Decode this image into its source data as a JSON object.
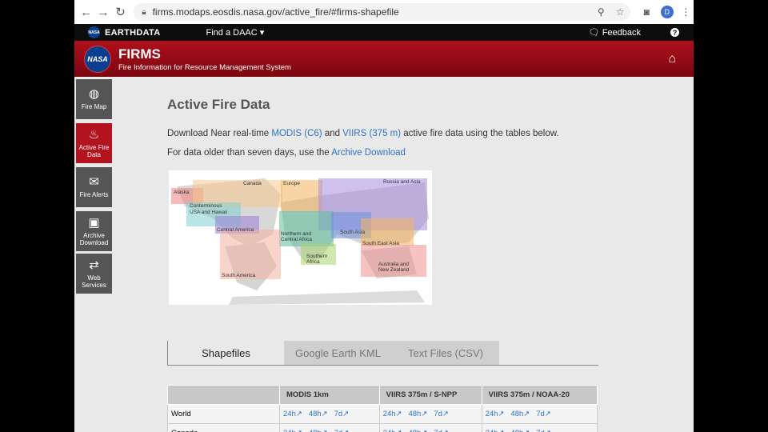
{
  "browser": {
    "url": "firms.modaps.eosdis.nasa.gov/active_fire/#firms-shapefile",
    "profile_initial": "D"
  },
  "earthdata": {
    "nasa_mark": "NASA",
    "brand": "EARTHDATA",
    "find_daac": "Find a DAAC ▾",
    "feedback": "Feedback",
    "help": "?"
  },
  "banner": {
    "logo": "NASA",
    "title": "FIRMS",
    "subtitle": "Fire Information for Resource Management System"
  },
  "sidebar": {
    "items": [
      {
        "label": "Fire Map",
        "icon": "globe-icon"
      },
      {
        "label": "Active Fire Data",
        "icon": "flame-icon"
      },
      {
        "label": "Fire Alerts",
        "icon": "envelope-icon"
      },
      {
        "label": "Archive Download",
        "icon": "archive-box-icon"
      },
      {
        "label": "Web Services",
        "icon": "swap-arrows-icon"
      }
    ]
  },
  "main": {
    "heading": "Active Fire Data",
    "p1_pre": "Download Near real-time ",
    "p1_link1": "MODIS (C6)",
    "p1_mid": " and ",
    "p1_link2": "VIIRS (375 m)",
    "p1_post": " active fire data using the tables below.",
    "p2_pre": "For data older than seven days, use the ",
    "p2_link": "Archive Download"
  },
  "map": {
    "regions": {
      "alaska": "Alaska",
      "canada": "Canada",
      "europe": "Europe",
      "russia": "Russia and Asia",
      "usa_line1": "Conterminous",
      "usa_line2": "USA and Hawaii",
      "central_america": "Central America",
      "n_africa_line1": "Northern and",
      "n_africa_line2": "Central Africa",
      "south_asia": "South Asia",
      "se_asia": "South East Asia",
      "s_africa_line1": "Southern",
      "s_africa_line2": "Africa",
      "australia_line1": "Australia and",
      "australia_line2": "New Zealand",
      "south_america": "South America"
    },
    "colors": {
      "alaska": "#f08080",
      "canada": "#f7c98c",
      "europe": "#f3b25f",
      "russia": "#a98de0",
      "usa": "#7fd1cd",
      "central_america": "#9b80d8",
      "n_africa": "#5bbf9b",
      "south_asia": "#6b8fe0",
      "se_asia": "#f7b45a",
      "s_africa": "#a9d46e",
      "australia": "#f09090",
      "south_america": "#f4b0a0"
    }
  },
  "tabs": [
    {
      "label": "Shapefiles",
      "active": true
    },
    {
      "label": "Google Earth KML",
      "active": false
    },
    {
      "label": "Text Files (CSV)",
      "active": false
    }
  ],
  "table": {
    "headers": [
      "",
      "MODIS 1km",
      "VIIRS 375m / S-NPP",
      "VIIRS 375m / NOAA-20"
    ],
    "links": [
      "24h↗",
      "48h↗",
      "7d↗"
    ],
    "rows": [
      "World",
      "Canada"
    ]
  }
}
